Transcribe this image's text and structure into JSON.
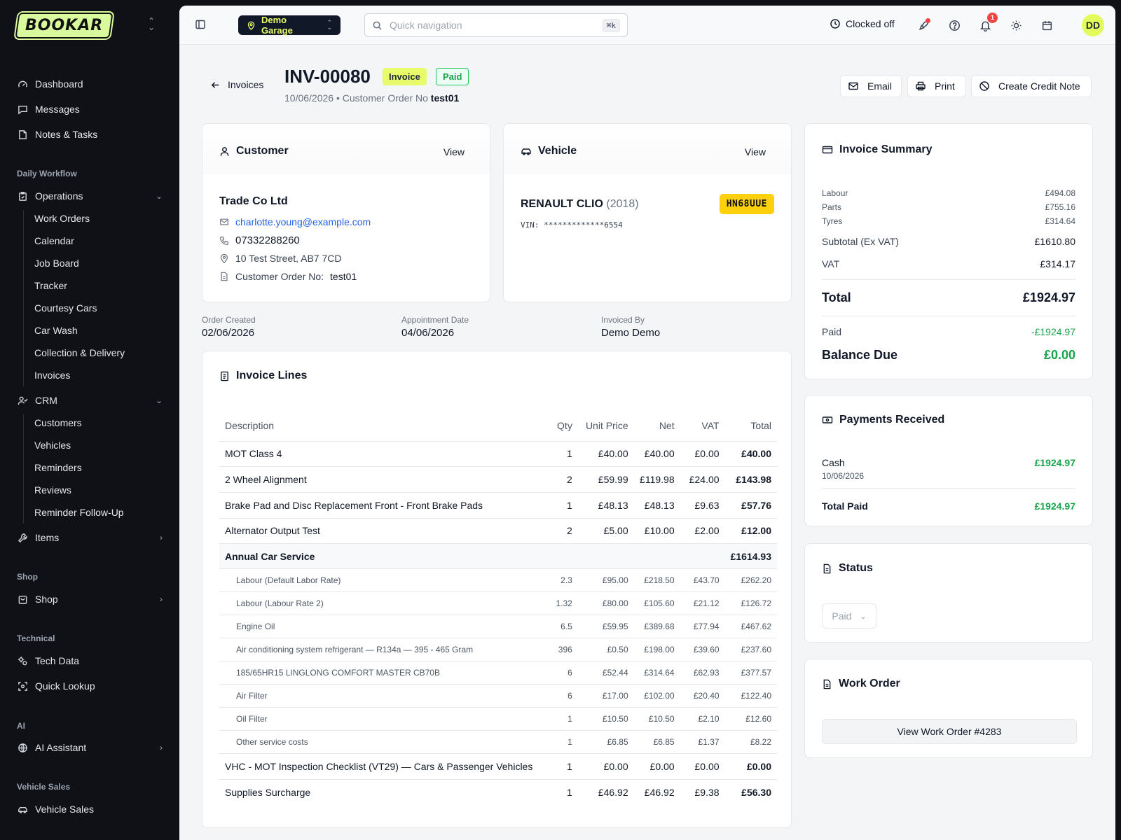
{
  "brand": {
    "name": "BOOKAR"
  },
  "sidebar": {
    "top": [
      {
        "label": "Dashboard",
        "icon": "gauge-icon"
      },
      {
        "label": "Messages",
        "icon": "message-icon"
      },
      {
        "label": "Notes & Tasks",
        "icon": "notes-icon"
      }
    ],
    "sections": {
      "daily_workflow": "Daily Workflow",
      "shop": "Shop",
      "technical": "Technical",
      "ai": "AI",
      "vehicle_sales": "Vehicle Sales"
    },
    "operations": {
      "label": "Operations",
      "items": [
        "Work Orders",
        "Calendar",
        "Job Board",
        "Tracker",
        "Courtesy Cars",
        "Car Wash",
        "Collection & Delivery",
        "Invoices"
      ]
    },
    "crm": {
      "label": "CRM",
      "items": [
        "Customers",
        "Vehicles",
        "Reminders",
        "Reviews",
        "Reminder Follow-Up"
      ]
    },
    "items_label": "Items",
    "shop_label": "Shop",
    "tech_data": "Tech Data",
    "quick_lookup": "Quick Lookup",
    "ai_assistant": "AI Assistant",
    "vehicle_sales": "Vehicle Sales"
  },
  "topbar": {
    "garage": "Demo Garage",
    "search_placeholder": "Quick navigation",
    "shortcut": "⌘k",
    "clock_status": "Clocked off",
    "notification_count": "1",
    "avatar": "DD"
  },
  "header": {
    "back": "Invoices",
    "invoice_number": "INV-00080",
    "type_badge": "Invoice",
    "status_badge": "Paid",
    "date": "10/06/2026",
    "order_label": "• Customer Order No",
    "order_no": "test01",
    "buttons": {
      "email": "Email",
      "print": "Print",
      "credit_note": "Create Credit Note"
    }
  },
  "customer": {
    "title": "Customer",
    "view": "View",
    "name": "Trade Co Ltd",
    "email": "charlotte.young@example.com",
    "phone": "07332288260",
    "address": "10 Test Street, AB7 7CD",
    "order_label": "Customer Order No:",
    "order_no": "test01"
  },
  "vehicle": {
    "title": "Vehicle",
    "view": "View",
    "make_model": "RENAULT CLIO",
    "year": "(2018)",
    "vin": "VIN: *************6554",
    "plate": "HN68UUE"
  },
  "meta": {
    "order_created_label": "Order Created",
    "order_created": "02/06/2026",
    "appointment_label": "Appointment Date",
    "appointment": "04/06/2026",
    "invoiced_by_label": "Invoiced By",
    "invoiced_by": "Demo Demo"
  },
  "invoice_lines": {
    "title": "Invoice Lines",
    "columns": [
      "Description",
      "Qty",
      "Unit Price",
      "Net",
      "VAT",
      "Total"
    ],
    "rows": [
      {
        "kind": "main",
        "cells": [
          "MOT Class 4",
          "1",
          "£40.00",
          "£40.00",
          "£0.00",
          "£40.00"
        ]
      },
      {
        "kind": "main",
        "cells": [
          "2 Wheel Alignment",
          "2",
          "£59.99",
          "£119.98",
          "£24.00",
          "£143.98"
        ]
      },
      {
        "kind": "main",
        "cells": [
          "Brake Pad and Disc Replacement Front - Front Brake Pads",
          "1",
          "£48.13",
          "£48.13",
          "£9.63",
          "£57.76"
        ]
      },
      {
        "kind": "main",
        "cells": [
          "Alternator Output Test",
          "2",
          "£5.00",
          "£10.00",
          "£2.00",
          "£12.00"
        ]
      },
      {
        "kind": "group",
        "cells": [
          "Annual Car Service",
          "",
          "",
          "",
          "",
          "£1614.93"
        ]
      },
      {
        "kind": "child",
        "cells": [
          "Labour (Default Labor Rate)",
          "2.3",
          "£95.00",
          "£218.50",
          "£43.70",
          "£262.20"
        ]
      },
      {
        "kind": "child",
        "cells": [
          "Labour (Labour Rate 2)",
          "1.32",
          "£80.00",
          "£105.60",
          "£21.12",
          "£126.72"
        ]
      },
      {
        "kind": "child",
        "cells": [
          "Engine Oil",
          "6.5",
          "£59.95",
          "£389.68",
          "£77.94",
          "£467.62"
        ]
      },
      {
        "kind": "child",
        "cells": [
          "Air conditioning system refrigerant — R134a — 395 - 465 Gram",
          "396",
          "£0.50",
          "£198.00",
          "£39.60",
          "£237.60"
        ]
      },
      {
        "kind": "child",
        "cells": [
          "185/65HR15 LINGLONG COMFORT MASTER CB70B",
          "6",
          "£52.44",
          "£314.64",
          "£62.93",
          "£377.57"
        ]
      },
      {
        "kind": "child",
        "cells": [
          "Air Filter",
          "6",
          "£17.00",
          "£102.00",
          "£20.40",
          "£122.40"
        ]
      },
      {
        "kind": "child",
        "cells": [
          "Oil Filter",
          "1",
          "£10.50",
          "£10.50",
          "£2.10",
          "£12.60"
        ]
      },
      {
        "kind": "child",
        "cells": [
          "Other service costs",
          "1",
          "£6.85",
          "£6.85",
          "£1.37",
          "£8.22"
        ]
      },
      {
        "kind": "main",
        "cells": [
          "VHC - MOT Inspection Checklist (VT29) — Cars & Passenger Vehicles",
          "1",
          "£0.00",
          "£0.00",
          "£0.00",
          "£0.00"
        ]
      },
      {
        "kind": "main",
        "cells": [
          "Supplies Surcharge",
          "1",
          "£46.92",
          "£46.92",
          "£9.38",
          "£56.30"
        ]
      }
    ]
  },
  "summary": {
    "title": "Invoice Summary",
    "labour_label": "Labour",
    "labour": "£494.08",
    "parts_label": "Parts",
    "parts": "£755.16",
    "tyres_label": "Tyres",
    "tyres": "£314.64",
    "subtotal_label": "Subtotal (Ex VAT)",
    "subtotal": "£1610.80",
    "vat_label": "VAT",
    "vat": "£314.17",
    "total_label": "Total",
    "total": "£1924.97",
    "paid_label": "Paid",
    "paid": "-£1924.97",
    "balance_label": "Balance Due",
    "balance": "£0.00"
  },
  "payments": {
    "title": "Payments Received",
    "method": "Cash",
    "date": "10/06/2026",
    "amount": "£1924.97",
    "total_label": "Total Paid",
    "total": "£1924.97"
  },
  "status": {
    "title": "Status",
    "value": "Paid"
  },
  "work_order": {
    "title": "Work Order",
    "button": "View Work Order #4283"
  },
  "colors": {
    "accent": "#e8fc6b",
    "sidebar_bg": "#0f1117",
    "paid_green": "#16a34a",
    "plate_yellow": "#fcd10b",
    "alert_red": "#ef4444"
  }
}
